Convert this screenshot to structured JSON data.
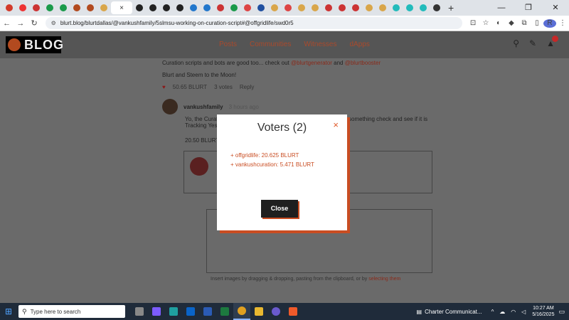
{
  "browser": {
    "url": "blurt.blog/blurtdallas/@vankushfamily/5slmsu-working-on-curation-script#@offgridlife/swd0r5",
    "tab_close": "×",
    "new_tab": "+",
    "window_controls": [
      "—",
      "❐",
      "✕"
    ],
    "profile_initial": "R",
    "tab_colors": [
      "#d23a2a",
      "#e33",
      "#c33",
      "#1a9a4a",
      "#1a9a4a",
      "#b24a1f",
      "#b24a1f",
      "#d9a64a",
      "#222",
      "#222",
      "#222",
      "#222",
      "#2277cc",
      "#2277cc",
      "#c33",
      "#1a9a4a",
      "#d44",
      "#1f4fa0",
      "#d9a64a",
      "#d44",
      "#d9a64a",
      "#d9a64a",
      "#c33",
      "#c33",
      "#c33",
      "#d9a64a",
      "#d9a64a",
      "#2bb",
      "#2bb",
      "#2bb",
      "#333"
    ]
  },
  "site": {
    "logo_text": "BLOG",
    "nav": [
      "Posts",
      "Communities",
      "Witnesses",
      "dApps"
    ]
  },
  "post": {
    "line1_prefix": "Curation scripts and bots are good too... check out ",
    "line1_link1": "@blurtgenerator",
    "line1_and": " and ",
    "line1_link2": "@blurtbooster",
    "line2": "Blurt and Steem to the Moon!",
    "payout": "50.65 BLURT",
    "votes": "3 votes",
    "reply": "Reply"
  },
  "comment": {
    "author": "vankushfamily",
    "time": "3 hours ago",
    "text_start": "Yo, the Curation",
    "text_end": "something check and see if it is",
    "text_line2": "Tracking Yes",
    "payout": "20.50 BLURT"
  },
  "editor": {
    "footer_prefix": "Insert images by dragging & dropping, pasting from the clipboard, or by ",
    "footer_link": "selecting them"
  },
  "modal": {
    "title": "Voters (2)",
    "close_x": "×",
    "voters": [
      "+ offgridlife: 20.625 BLURT",
      "+ vankushcuration: 5.471 BLURT"
    ],
    "close_label": "Close"
  },
  "taskbar": {
    "search_placeholder": "Type here to search",
    "weather": "Charter Communicat...",
    "time": "10:27 AM",
    "date": "5/16/2025"
  }
}
